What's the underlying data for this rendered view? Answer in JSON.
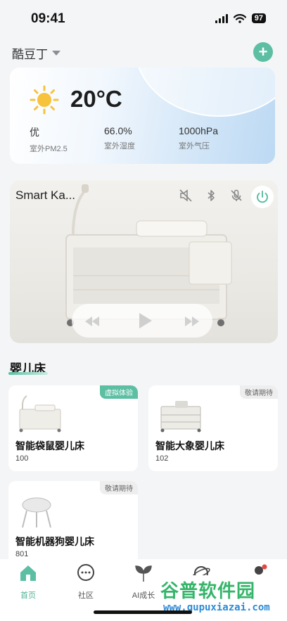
{
  "status_bar": {
    "time": "09:41",
    "battery": "97"
  },
  "header": {
    "home_name": "酷豆丁"
  },
  "weather": {
    "temperature": "20°C",
    "metrics": [
      {
        "value": "优",
        "label": "室外PM2.5"
      },
      {
        "value": "66.0%",
        "label": "室外湿度"
      },
      {
        "value": "1000hPa",
        "label": "室外气压"
      }
    ]
  },
  "device": {
    "name": "Smart Ka...",
    "status_icons": [
      "mute-icon",
      "bluetooth-icon",
      "mic-off-icon"
    ],
    "power_icon": "power-icon"
  },
  "section": {
    "title": "婴儿床"
  },
  "products": [
    {
      "name": "智能袋鼠婴儿床",
      "count": "100",
      "badge": "虚拟体验",
      "badge_style": "green"
    },
    {
      "name": "智能大象婴儿床",
      "count": "102",
      "badge": "敬请期待",
      "badge_style": "grey"
    },
    {
      "name": "智能机器狗婴儿床",
      "count": "801",
      "badge": "敬请期待",
      "badge_style": "grey"
    }
  ],
  "tabs": [
    {
      "label": "首页",
      "icon": "home-icon",
      "active": true
    },
    {
      "label": "社区",
      "icon": "chat-icon",
      "active": false
    },
    {
      "label": "AI成长",
      "icon": "sprout-icon",
      "active": false
    },
    {
      "label": "",
      "icon": "planet-icon",
      "active": false
    },
    {
      "label": "",
      "icon": "profile-icon",
      "active": false
    }
  ],
  "watermark": {
    "title": "谷普软件园",
    "url": "www.gupuxiazai.com"
  },
  "colors": {
    "accent": "#5cbfa3",
    "background": "#f4f5f6"
  }
}
